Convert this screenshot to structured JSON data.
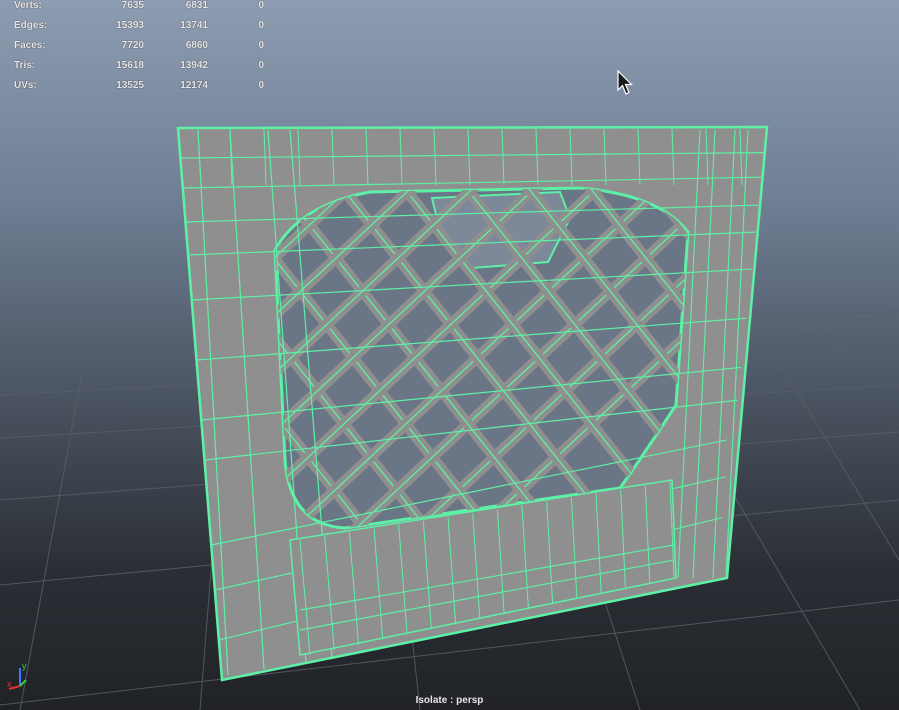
{
  "stats": {
    "rows": [
      {
        "label": "Verts:",
        "values": [
          "7635",
          "6831",
          "0"
        ]
      },
      {
        "label": "Edges:",
        "values": [
          "15393",
          "13741",
          "0"
        ]
      },
      {
        "label": "Faces:",
        "values": [
          "7720",
          "6860",
          "0"
        ]
      },
      {
        "label": "Tris:",
        "values": [
          "15618",
          "13942",
          "0"
        ]
      },
      {
        "label": "UVs:",
        "values": [
          "13525",
          "12174",
          "0"
        ]
      }
    ]
  },
  "viewport": {
    "camera_label": "Isolate : persp",
    "axis_x": "x",
    "axis_y": "y",
    "wire_color": "#5ef0a6",
    "face_color": "#8f8f8f",
    "grid_color": "#5a5f66"
  }
}
